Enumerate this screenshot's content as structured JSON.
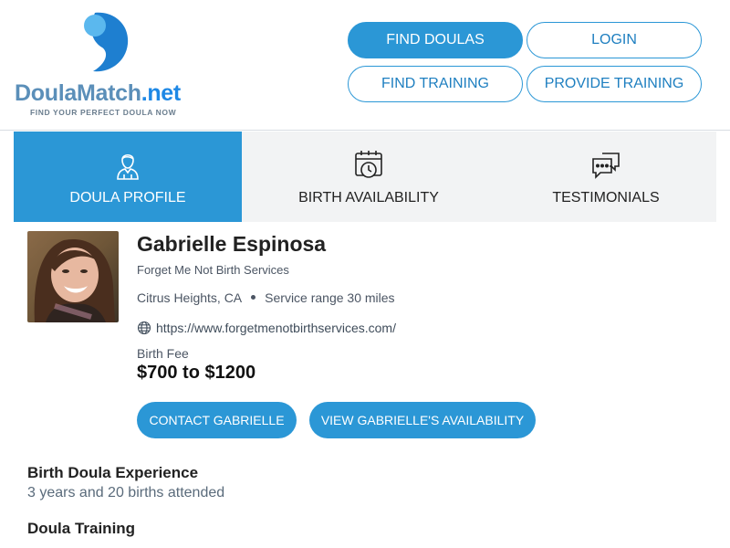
{
  "brand": {
    "name_main": "DoulaMatch",
    "name_suffix": ".net",
    "tagline": "FIND YOUR PERFECT DOULA NOW",
    "colors": {
      "primary": "#2b97d6",
      "logo_light": "#5bb8ee",
      "logo_dark": "#1e7fd0"
    }
  },
  "nav": {
    "find_doulas": "FIND DOULAS",
    "login": "LOGIN",
    "find_training": "FIND TRAINING",
    "provide_training": "PROVIDE TRAINING"
  },
  "tabs": [
    {
      "label": "DOULA PROFILE",
      "icon": "doula-person-icon",
      "active": true
    },
    {
      "label": "BIRTH AVAILABILITY",
      "icon": "calendar-clock-icon",
      "active": false
    },
    {
      "label": "TESTIMONIALS",
      "icon": "chat-bubbles-icon",
      "active": false
    }
  ],
  "profile": {
    "name": "Gabrielle Espinosa",
    "business": "Forget Me Not Birth Services",
    "location": "Citrus Heights, CA",
    "service_range": "Service range 30 miles",
    "website": "https://www.forgetmenotbirthservices.com/",
    "fee_label": "Birth Fee",
    "fee_value": "$700 to $1200",
    "contact_button": "CONTACT GABRIELLE",
    "availability_button": "VIEW GABRIELLE'S AVAILABILITY"
  },
  "sections": {
    "experience_title": "Birth Doula Experience",
    "experience_text": "3 years and 20 births attended",
    "training_title": "Doula Training"
  }
}
